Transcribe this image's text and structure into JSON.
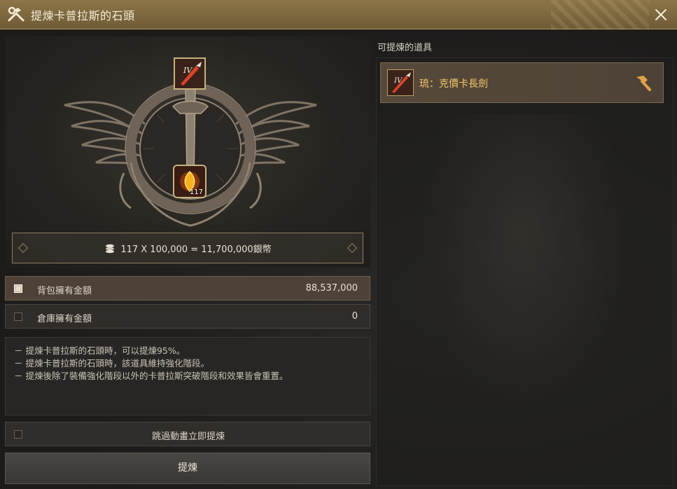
{
  "window": {
    "title": "提煉卡普拉斯的石頭"
  },
  "emblem": {
    "top_slot_level": "IV",
    "bottom_slot_count": "117"
  },
  "cost": {
    "text": "117 X 100,000 = 11,700,000銀幣"
  },
  "money": [
    {
      "label": "背包擁有金額",
      "amount": "88,537,000",
      "checked": true
    },
    {
      "label": "倉庫擁有金額",
      "amount": "0",
      "checked": false
    }
  ],
  "notes": [
    "－ 提煉卡普拉斯的石頭時，可以提煉95%。",
    "－ 提煉卡普拉斯的石頭時，該道具維持強化階段。",
    "－ 提煉後除了裝備強化階段以外的卡普拉斯突破階段和效果皆會重置。"
  ],
  "skip": {
    "label": "跳過動畫立即提煉",
    "checked": false
  },
  "refine_button": {
    "label": "提煉"
  },
  "right_panel": {
    "header": "可提煉的道具",
    "items": [
      {
        "name": "琉：克價卡長劍",
        "level": "IV",
        "color": "#f1c76a"
      }
    ]
  },
  "colors": {
    "accent_gold": "#c8b27e",
    "titlebar": "#8c7547",
    "item_name": "#f1c76a"
  }
}
